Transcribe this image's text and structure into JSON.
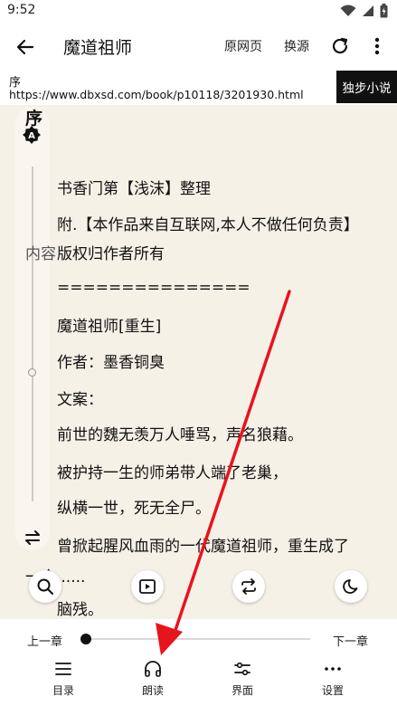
{
  "status_bar": {
    "time": "9:52"
  },
  "app_bar": {
    "title": "魔道祖师",
    "original_page_label": "原网页",
    "change_source_label": "换源"
  },
  "info_bar": {
    "chapter_title": "序",
    "url": "https://www.dbxsd.com/book/p10118/3201930.html",
    "source_name": "独步小说"
  },
  "content": {
    "heading": "序",
    "side_label": "内容",
    "paragraphs": [
      "书香门第【浅沫】整理",
      "附.【本作品来自互联网,本人不做任何负责】",
      "版权归作者所有",
      "===============",
      "魔道祖师[重生]",
      "作者：墨香铜臭",
      "文案：",
      "前世的魏无羡万人唾骂，声名狼藉。",
      "被护持一生的师弟带人端了老巢，",
      "纵横一世，死无全尸。",
      "曾掀起腥风血雨的一代魔道祖师，重生成了",
      "一个......",
      "脑残。"
    ]
  },
  "controls": {
    "prev_chapter": "上一章",
    "next_chapter": "下一章",
    "chapter_progress": 0.0,
    "nav": [
      {
        "label": "目录",
        "icon": "list-icon"
      },
      {
        "label": "朗读",
        "icon": "headphones-icon"
      },
      {
        "label": "界面",
        "icon": "sliders-icon"
      },
      {
        "label": "设置",
        "icon": "more-horizontal-icon"
      }
    ],
    "floating_buttons": [
      "search-icon",
      "play-icon",
      "repeat-icon",
      "night-mode-icon"
    ]
  },
  "annotation": {
    "arrow_color": "#e8141c"
  }
}
